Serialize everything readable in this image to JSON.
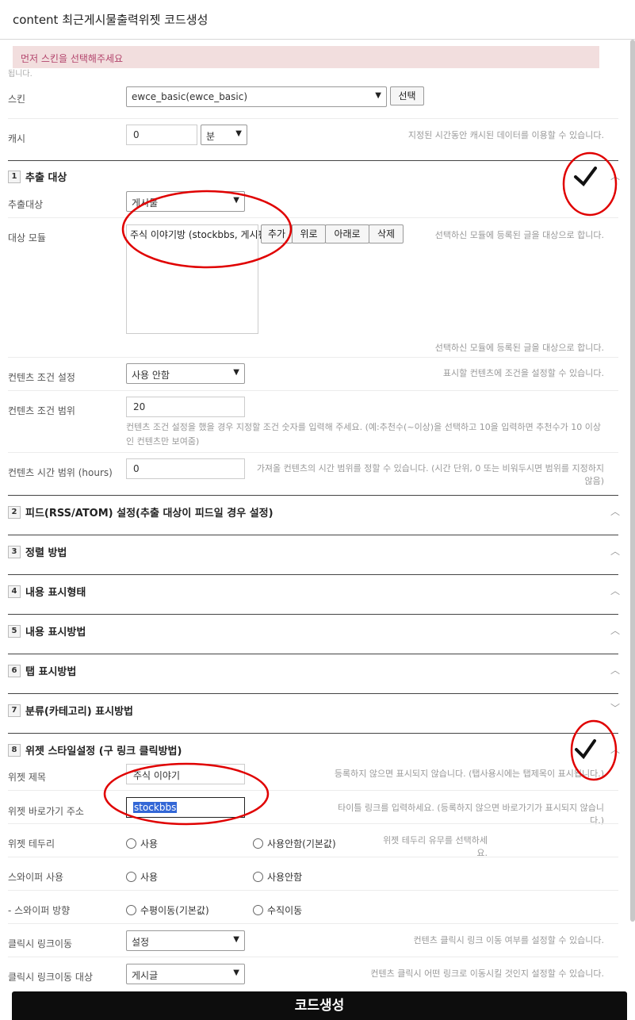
{
  "header": {
    "title": "content 최근게시물출력위젯 코드생성"
  },
  "alert": {
    "text": "먼저 스킨을 선택해주세요"
  },
  "cut_text": "됩니다.",
  "skin": {
    "label": "스킨",
    "value": "ewce_basic(ewce_basic)",
    "select_button": "선택"
  },
  "cache": {
    "label": "캐시",
    "value": "0",
    "unit": "분",
    "help": "지정된 시간동안 캐시된 데이터를 이용할 수 있습니다."
  },
  "section1": {
    "number": "1",
    "title": "추출 대상",
    "target": {
      "label": "추출대상",
      "value": "게시물"
    },
    "module": {
      "label": "대상 모듈",
      "items": [
        "주식 이야기방 (stockbbs, 게시판)"
      ],
      "buttons": {
        "add": "추가",
        "up": "위로",
        "down": "아래로",
        "delete": "삭제"
      },
      "help": "선택하신 모듈에 등록된 글을 대상으로 합니다.",
      "help2": "선택하신 모듈에 등록된 글을 대상으로 합니다."
    },
    "condition": {
      "label": "컨텐츠 조건 설정",
      "value": "사용 안함",
      "help": "표시할 컨텐츠에 조건을 설정할 수 있습니다."
    },
    "range": {
      "label": "컨텐츠 조건 범위",
      "value": "20",
      "help": "컨텐츠 조건 설정을 했을 경우 지정할 조건 숫자를 입력해 주세요. (예:추천수(~이상)을 선택하고 10을 입력하면 추천수가 10 이상인 컨텐츠만 보여줌)"
    },
    "time": {
      "label": "컨텐츠 시간 범위 (hours)",
      "value": "0",
      "help": "가져올 컨텐츠의 시간 범위를 정할 수 있습니다. (시간 단위, 0 또는 비워두시면 범위를 지정하지 않음)"
    }
  },
  "sections": [
    {
      "number": "2",
      "title": "피드(RSS/ATOM) 설정(추출 대상이 피드일 경우 설정)",
      "chevron": "up"
    },
    {
      "number": "3",
      "title": "정렬 방법",
      "chevron": "up"
    },
    {
      "number": "4",
      "title": "내용 표시형태",
      "chevron": "up"
    },
    {
      "number": "5",
      "title": "내용 표시방법",
      "chevron": "up"
    },
    {
      "number": "6",
      "title": "탭 표시방법",
      "chevron": "up"
    },
    {
      "number": "7",
      "title": "분류(카테고리) 표시방법",
      "chevron": "down"
    }
  ],
  "section8": {
    "number": "8",
    "title": "위젯 스타일설정 (구 링크 클릭방법)",
    "widget_title": {
      "label": "위젯 제목",
      "value": "주식 이야기",
      "help": "등록하지 않으면 표시되지 않습니다. (탭사용시에는 탭제목이 표시됩니다.)"
    },
    "widget_link": {
      "label": "위젯 바로가기 주소",
      "value": "stockbbs",
      "help": "타이틀 링크를 입력하세요. (등록하지 않으면 바로가기가 표시되지 않습니다.)"
    },
    "border": {
      "label": "위젯 테두리",
      "option1": "사용",
      "option2": "사용안함(기본값)",
      "help": "위젯 테두리 유무를 선택하세요."
    },
    "swiper": {
      "label": "스와이퍼 사용",
      "option1": "사용",
      "option2": "사용안함"
    },
    "swiper_dir": {
      "label": "- 스와이퍼 방향",
      "option1": "수평이동(기본값)",
      "option2": "수직이동"
    },
    "click_link": {
      "label": "클릭시 링크이동",
      "value": "설정",
      "help": "컨텐츠 클릭시 링크 이동 여부를 설정할 수 있습니다."
    },
    "click_target": {
      "label": "클릭시 링크이동 대상",
      "value": "게시글",
      "help": "컨텐츠 클릭시 어떤 링크로 이동시킬 것인지 설정할 수 있습니다."
    }
  },
  "generate_button": "코드생성",
  "colors": {
    "alert_bg": "#f2dede",
    "alert_text": "#b3446c",
    "annotation": "#e00000",
    "button_bg": "#0d0d0d"
  },
  "icons": {
    "select_caret": "chevron-down-icon",
    "section_toggle": "chevron-up-icon",
    "annotation_check": "checkmark-icon"
  }
}
